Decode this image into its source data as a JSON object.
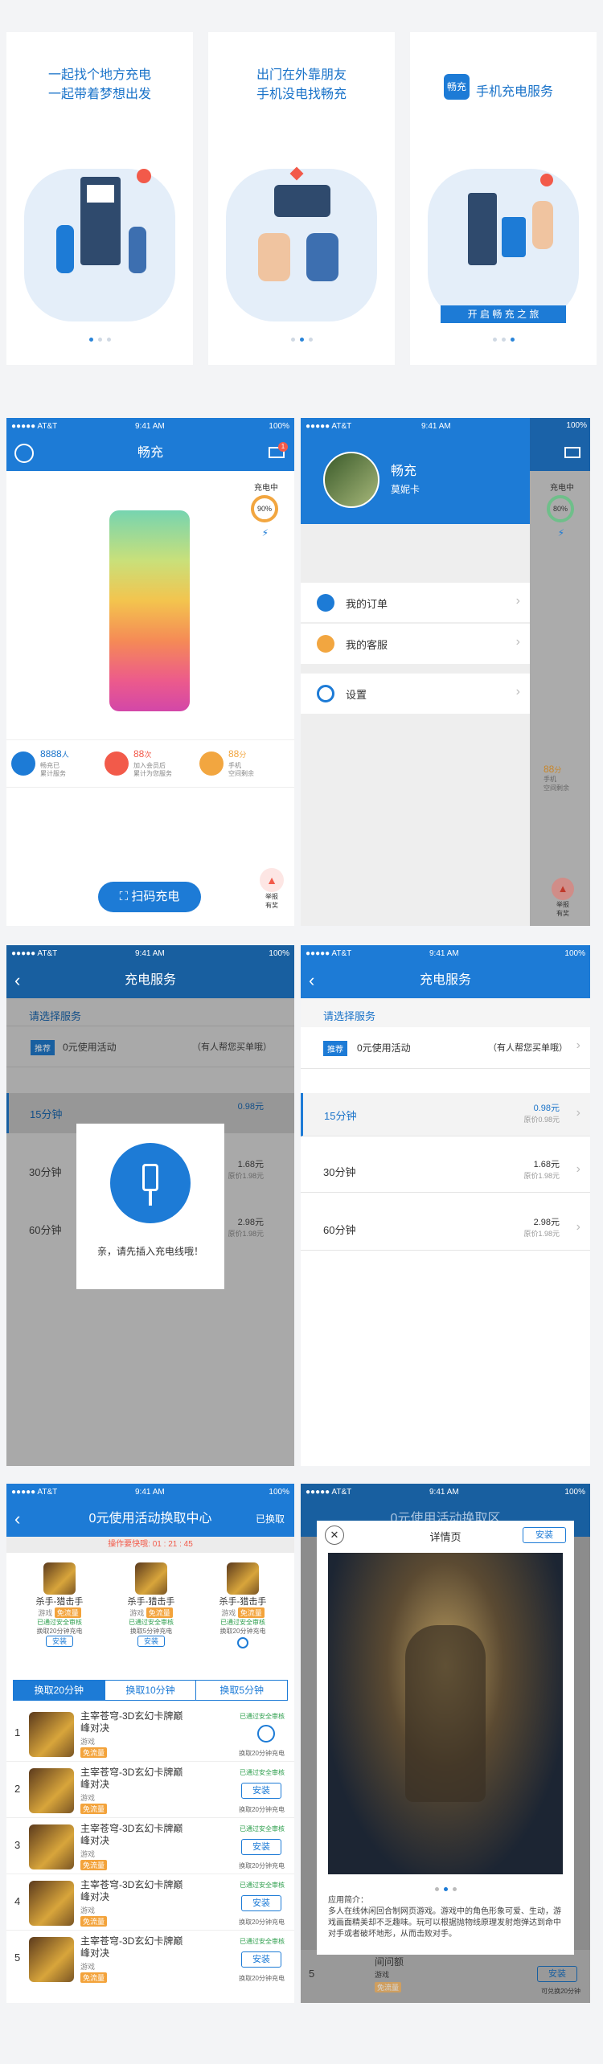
{
  "onboarding": [
    {
      "line1": "一起找个地方充电",
      "line2": "一起带着梦想出发"
    },
    {
      "line1": "出门在外靠朋友",
      "line2": "手机没电找畅充"
    },
    {
      "line1": "手机充电服务",
      "line2": "",
      "logo": "畅充",
      "cta": "开 启 畅 充 之 旅"
    }
  ],
  "status": {
    "carrier": "●●●●● AT&T",
    "time": "9:41 AM",
    "battery": "100%"
  },
  "home": {
    "title": "畅充",
    "badge": "1",
    "charging_label": "充电中",
    "percent": "90%",
    "stats": [
      {
        "num": "8888",
        "unit": "人",
        "l1": "畅充已",
        "l2": "累计服务"
      },
      {
        "num": "88",
        "unit": "次",
        "l1": "加入会员后",
        "l2": "累计为您服务"
      },
      {
        "num": "88",
        "unit": "分",
        "l1": "手机",
        "l2": "空间剩余"
      }
    ],
    "scan_label": "扫码充电",
    "report1": "举报",
    "report2": "有奖"
  },
  "drawer": {
    "app_name": "畅充",
    "user": "莫妮卡",
    "percent": "80%",
    "charging_label": "充电中",
    "menu": [
      "我的订单",
      "我的客服",
      "设置"
    ],
    "stat": {
      "num": "88",
      "unit": "分",
      "l1": "手机",
      "l2": "空间剩余"
    },
    "report1": "举报",
    "report2": "有奖"
  },
  "service": {
    "title": "充电服务",
    "prompt": "请选择服务",
    "tag": "推荐",
    "free_label": "0元使用活动",
    "free_hint": "（有人帮您买单哦）",
    "plans": [
      {
        "label": "15分钟",
        "price": "0.98元",
        "orig": "原价0.98元"
      },
      {
        "label": "30分钟",
        "price": "1.68元",
        "orig": "原价1.98元"
      },
      {
        "label": "60分钟",
        "price": "2.98元",
        "orig": "原价1.98元"
      }
    ],
    "dialog_text": "亲，请先插入充电线哦！"
  },
  "exchange": {
    "title": "0元使用活动换取中心",
    "action": "已换取",
    "countdown_label": "操作要快哦:",
    "countdown": "01 : 21 : 45",
    "top": [
      {
        "name": "杀手-猎击手",
        "cat": "游戏",
        "tag": "免流量",
        "safe": "已通过安全审核",
        "reward": "换取20分钟充电"
      },
      {
        "name": "杀手-猎击手",
        "cat": "游戏",
        "tag": "免流量",
        "safe": "已通过安全审核",
        "reward": "换取5分钟充电"
      },
      {
        "name": "杀手-猎击手",
        "cat": "游戏",
        "tag": "免流量",
        "safe": "已通过安全审核",
        "reward": "换取20分钟充电"
      }
    ],
    "top_install": "安装",
    "tabs": [
      "换取20分钟",
      "换取10分钟",
      "换取5分钟"
    ],
    "list": [
      {
        "idx": "1",
        "name1": "主宰苍穹-3D玄幻卡牌巅",
        "name2": "峰对决",
        "cat": "游戏",
        "tag": "免流量",
        "safe": "已通过安全审核",
        "reward": "换取20分钟充电",
        "btn": ""
      },
      {
        "idx": "2",
        "name1": "主宰苍穹-3D玄幻卡牌巅",
        "name2": "峰对决",
        "cat": "游戏",
        "tag": "免流量",
        "safe": "已通过安全审核",
        "reward": "换取20分钟充电",
        "btn": "安装"
      },
      {
        "idx": "3",
        "name1": "主宰苍穹-3D玄幻卡牌巅",
        "name2": "峰对决",
        "cat": "游戏",
        "tag": "免流量",
        "safe": "已通过安全审核",
        "reward": "换取20分钟充电",
        "btn": "安装"
      },
      {
        "idx": "4",
        "name1": "主宰苍穹-3D玄幻卡牌巅",
        "name2": "峰对决",
        "cat": "游戏",
        "tag": "免流量",
        "safe": "已通过安全审核",
        "reward": "换取20分钟充电",
        "btn": "安装"
      },
      {
        "idx": "5",
        "name1": "主宰苍穹-3D玄幻卡牌巅",
        "name2": "峰对决",
        "cat": "游戏",
        "tag": "免流量",
        "safe": "已通过安全审核",
        "reward": "换取20分钟充电",
        "btn": "安装"
      }
    ]
  },
  "detail": {
    "header": "详情页",
    "install": "安装",
    "intro_title": "应用简介：",
    "intro": "多人在线休闲回合制网页游戏。游戏中的角色形象可爱、生动，游戏画面精美却不乏趣味。玩可以根据抛物线原理发射炮弹达到命中对手或者破坏地形，从而击败对手。",
    "bg_title": "0元使用活动换取区",
    "bg_row_name": "间问额",
    "bg_row_cat": "游戏",
    "bg_row_tag": "免流量",
    "bg_row_btn": "安装",
    "bg_row_reward": "可兑换20分钟",
    "bg_idx": "5"
  }
}
